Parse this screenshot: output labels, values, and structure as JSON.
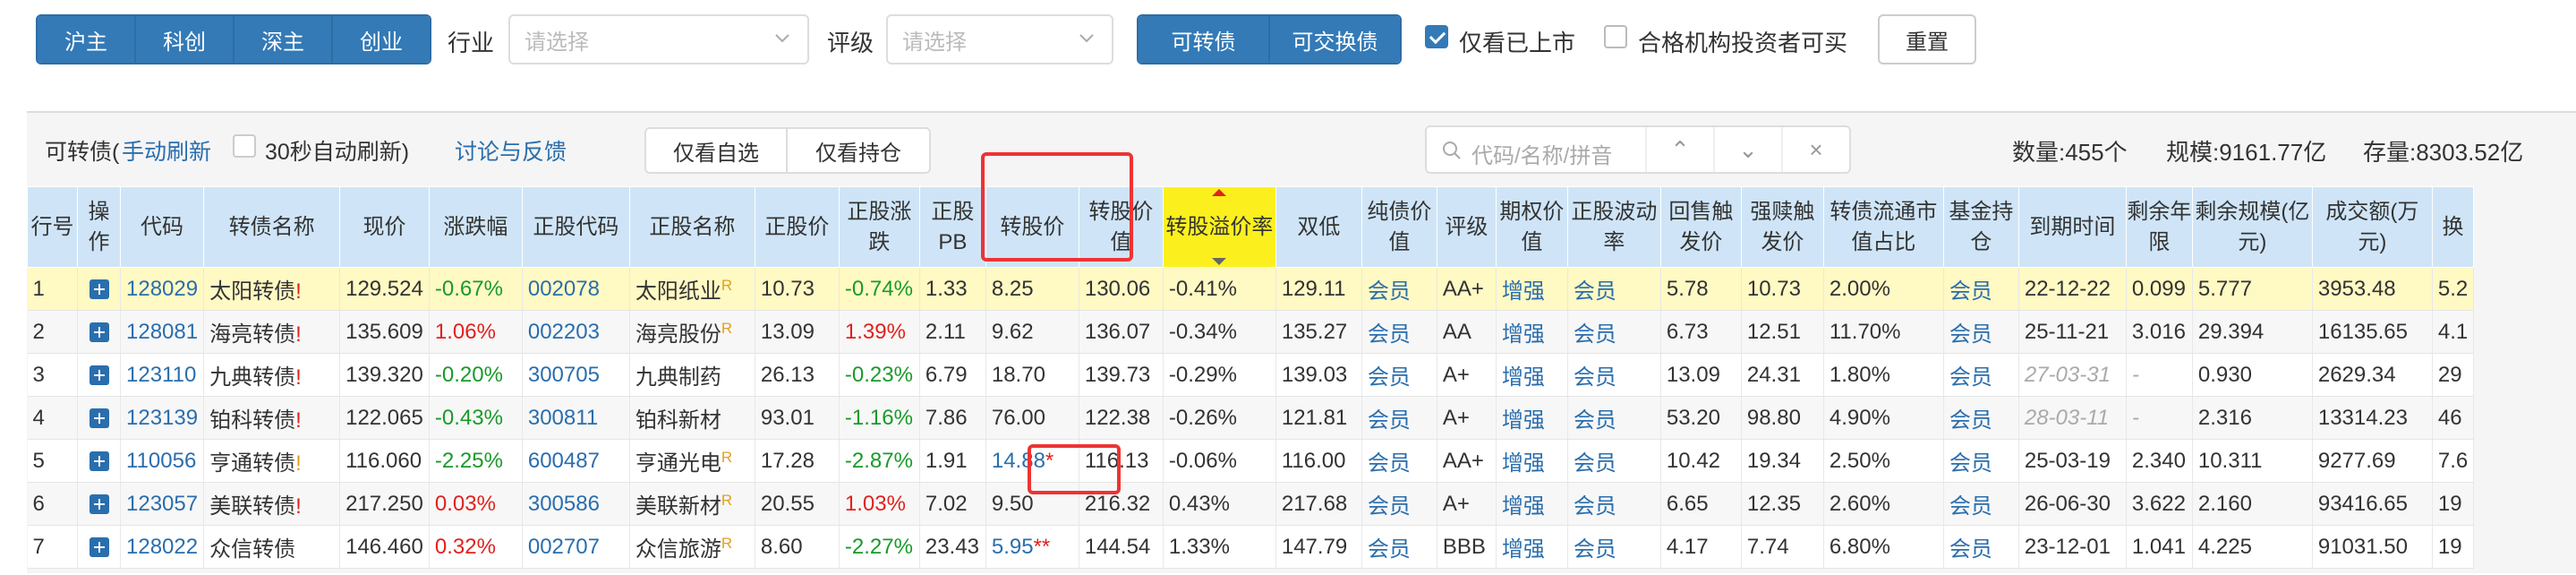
{
  "market_tabs": [
    "沪主",
    "科创",
    "深主",
    "创业"
  ],
  "filters": {
    "industry_label": "行业",
    "industry_placeholder": "请选择",
    "rating_label": "评级",
    "rating_placeholder": "请选择"
  },
  "convert_tabs": [
    "可转债",
    "可交换债"
  ],
  "only_listed": {
    "label": "仅看已上市",
    "checked": true
  },
  "qualified_investor": {
    "label": "合格机构投资者可买",
    "checked": false
  },
  "reset_label": "重置",
  "toolbar": {
    "title": "可转债(",
    "manual_refresh": "手动刷新",
    "auto_refresh": "30秒自动刷新)",
    "feedback": "讨论与反馈",
    "only_watchlist": "仅看自选",
    "only_holdings": "仅看持仓",
    "search_placeholder": "代码/名称/拼音",
    "nav_up": "⌃",
    "nav_down": "⌄",
    "nav_clear": "×",
    "count": "数量:455个",
    "scale": "规模:9161.77亿",
    "remaining": "存量:8303.52亿"
  },
  "columns": [
    {
      "label": "行号"
    },
    {
      "label": "操作"
    },
    {
      "label": "代码"
    },
    {
      "label": "转债名称"
    },
    {
      "label": "现价"
    },
    {
      "label": "涨跌幅"
    },
    {
      "label": "正股代码"
    },
    {
      "label": "正股名称"
    },
    {
      "label": "正股价"
    },
    {
      "label": "正股涨跌"
    },
    {
      "label": "正股PB"
    },
    {
      "label": "转股价"
    },
    {
      "label": "转股价值"
    },
    {
      "label": "转股溢价率"
    },
    {
      "label": "双低"
    },
    {
      "label": "纯债价值"
    },
    {
      "label": "评级"
    },
    {
      "label": "期权价值"
    },
    {
      "label": "正股波动率"
    },
    {
      "label": "回售触发价"
    },
    {
      "label": "强赎触发价"
    },
    {
      "label": "转债流通市值占比"
    },
    {
      "label": "基金持仓"
    },
    {
      "label": "到期时间"
    },
    {
      "label": "剩余年限"
    },
    {
      "label": "剩余规模(亿元)"
    },
    {
      "label": "成交额(万元)"
    },
    {
      "label": "换"
    }
  ],
  "rows": [
    {
      "no": "1",
      "code": "128029",
      "name": "太阳转债",
      "mark": "!",
      "mark_color": "red",
      "price": "129.524",
      "chg": "-0.67%",
      "scode": "002078",
      "sname": "太阳纸业",
      "sname_sup": "R",
      "sprice": "10.73",
      "schg": "-0.74%",
      "pb": "1.33",
      "cprice": "8.25",
      "cprice_mark": "",
      "cvalue": "130.06",
      "premium": "-0.41%",
      "dlow": "129.11",
      "bond_value": "会员",
      "rating": "AA+",
      "option": "增强",
      "vol": "会员",
      "putback": "5.78",
      "redeem": "10.73",
      "ratio": "2.00%",
      "fund": "会员",
      "maturity": "22-12-22",
      "maturity_gray": false,
      "years": "0.099",
      "size": "5.777",
      "turnover": "3953.48",
      "swap": "5.2"
    },
    {
      "no": "2",
      "code": "128081",
      "name": "海亮转债",
      "mark": "!",
      "mark_color": "red",
      "price": "135.609",
      "chg": "1.06%",
      "scode": "002203",
      "sname": "海亮股份",
      "sname_sup": "R",
      "sprice": "13.09",
      "schg": "1.39%",
      "pb": "2.11",
      "cprice": "9.62",
      "cprice_mark": "",
      "cvalue": "136.07",
      "premium": "-0.34%",
      "dlow": "135.27",
      "bond_value": "会员",
      "rating": "AA",
      "option": "增强",
      "vol": "会员",
      "putback": "6.73",
      "redeem": "12.51",
      "ratio": "11.70%",
      "fund": "会员",
      "maturity": "25-11-21",
      "maturity_gray": false,
      "years": "3.016",
      "size": "29.394",
      "turnover": "16135.65",
      "swap": "4.1"
    },
    {
      "no": "3",
      "code": "123110",
      "name": "九典转债",
      "mark": "!",
      "mark_color": "red",
      "price": "139.320",
      "chg": "-0.20%",
      "scode": "300705",
      "sname": "九典制药",
      "sname_sup": "",
      "sprice": "26.13",
      "schg": "-0.23%",
      "pb": "6.79",
      "cprice": "18.70",
      "cprice_mark": "",
      "cvalue": "139.73",
      "premium": "-0.29%",
      "dlow": "139.03",
      "bond_value": "会员",
      "rating": "A+",
      "option": "增强",
      "vol": "会员",
      "putback": "13.09",
      "redeem": "24.31",
      "ratio": "1.80%",
      "fund": "会员",
      "maturity": "27-03-31",
      "maturity_gray": true,
      "years": "-",
      "size": "0.930",
      "turnover": "2629.34",
      "swap": "29"
    },
    {
      "no": "4",
      "code": "123139",
      "name": "铂科转债",
      "mark": "!",
      "mark_color": "red",
      "price": "122.065",
      "chg": "-0.43%",
      "scode": "300811",
      "sname": "铂科新材",
      "sname_sup": "",
      "sprice": "93.01",
      "schg": "-1.16%",
      "pb": "7.86",
      "cprice": "76.00",
      "cprice_mark": "",
      "cvalue": "122.38",
      "premium": "-0.26%",
      "dlow": "121.81",
      "bond_value": "会员",
      "rating": "A+",
      "option": "增强",
      "vol": "会员",
      "putback": "53.20",
      "redeem": "98.80",
      "ratio": "4.90%",
      "fund": "会员",
      "maturity": "28-03-11",
      "maturity_gray": true,
      "years": "-",
      "size": "2.316",
      "turnover": "13314.23",
      "swap": "46"
    },
    {
      "no": "5",
      "code": "110056",
      "name": "亨通转债",
      "mark": "!",
      "mark_color": "yellow",
      "price": "116.060",
      "chg": "-2.25%",
      "scode": "600487",
      "sname": "亨通光电",
      "sname_sup": "R",
      "sprice": "17.28",
      "schg": "-2.87%",
      "pb": "1.91",
      "cprice": "14.88",
      "cprice_mark": "*",
      "cvalue": "116.13",
      "premium": "-0.06%",
      "dlow": "116.00",
      "bond_value": "会员",
      "rating": "AA+",
      "option": "增强",
      "vol": "会员",
      "putback": "10.42",
      "redeem": "19.34",
      "ratio": "2.50%",
      "fund": "会员",
      "maturity": "25-03-19",
      "maturity_gray": false,
      "years": "2.340",
      "size": "10.311",
      "turnover": "9277.69",
      "swap": "7.6"
    },
    {
      "no": "6",
      "code": "123057",
      "name": "美联转债",
      "mark": "!",
      "mark_color": "red",
      "price": "217.250",
      "chg": "0.03%",
      "scode": "300586",
      "sname": "美联新材",
      "sname_sup": "R",
      "sprice": "20.55",
      "schg": "1.03%",
      "pb": "7.02",
      "cprice": "9.50",
      "cprice_mark": "",
      "cvalue": "216.32",
      "premium": "0.43%",
      "dlow": "217.68",
      "bond_value": "会员",
      "rating": "A+",
      "option": "增强",
      "vol": "会员",
      "putback": "6.65",
      "redeem": "12.35",
      "ratio": "2.60%",
      "fund": "会员",
      "maturity": "26-06-30",
      "maturity_gray": false,
      "years": "3.622",
      "size": "2.160",
      "turnover": "93416.65",
      "swap": "19"
    },
    {
      "no": "7",
      "code": "128022",
      "name": "众信转债",
      "mark": "",
      "mark_color": "",
      "price": "146.460",
      "chg": "0.32%",
      "scode": "002707",
      "sname": "众信旅游",
      "sname_sup": "R",
      "sprice": "8.60",
      "schg": "-2.27%",
      "pb": "23.43",
      "cprice": "5.95",
      "cprice_mark": "**",
      "cvalue": "144.54",
      "premium": "1.33%",
      "dlow": "147.79",
      "bond_value": "会员",
      "rating": "BBB",
      "option": "增强",
      "vol": "会员",
      "putback": "4.17",
      "redeem": "7.74",
      "ratio": "6.80%",
      "fund": "会员",
      "maturity": "23-12-01",
      "maturity_gray": false,
      "years": "1.041",
      "size": "4.225",
      "turnover": "91031.50",
      "swap": "19"
    }
  ],
  "colors": {
    "primary": "#337ab7",
    "link": "#2a6ead",
    "up": "#e0221f",
    "down": "#1a9a2a",
    "header": "#cfe5f7",
    "highlight": "#fbf01e",
    "annotation": "#ee3333"
  }
}
